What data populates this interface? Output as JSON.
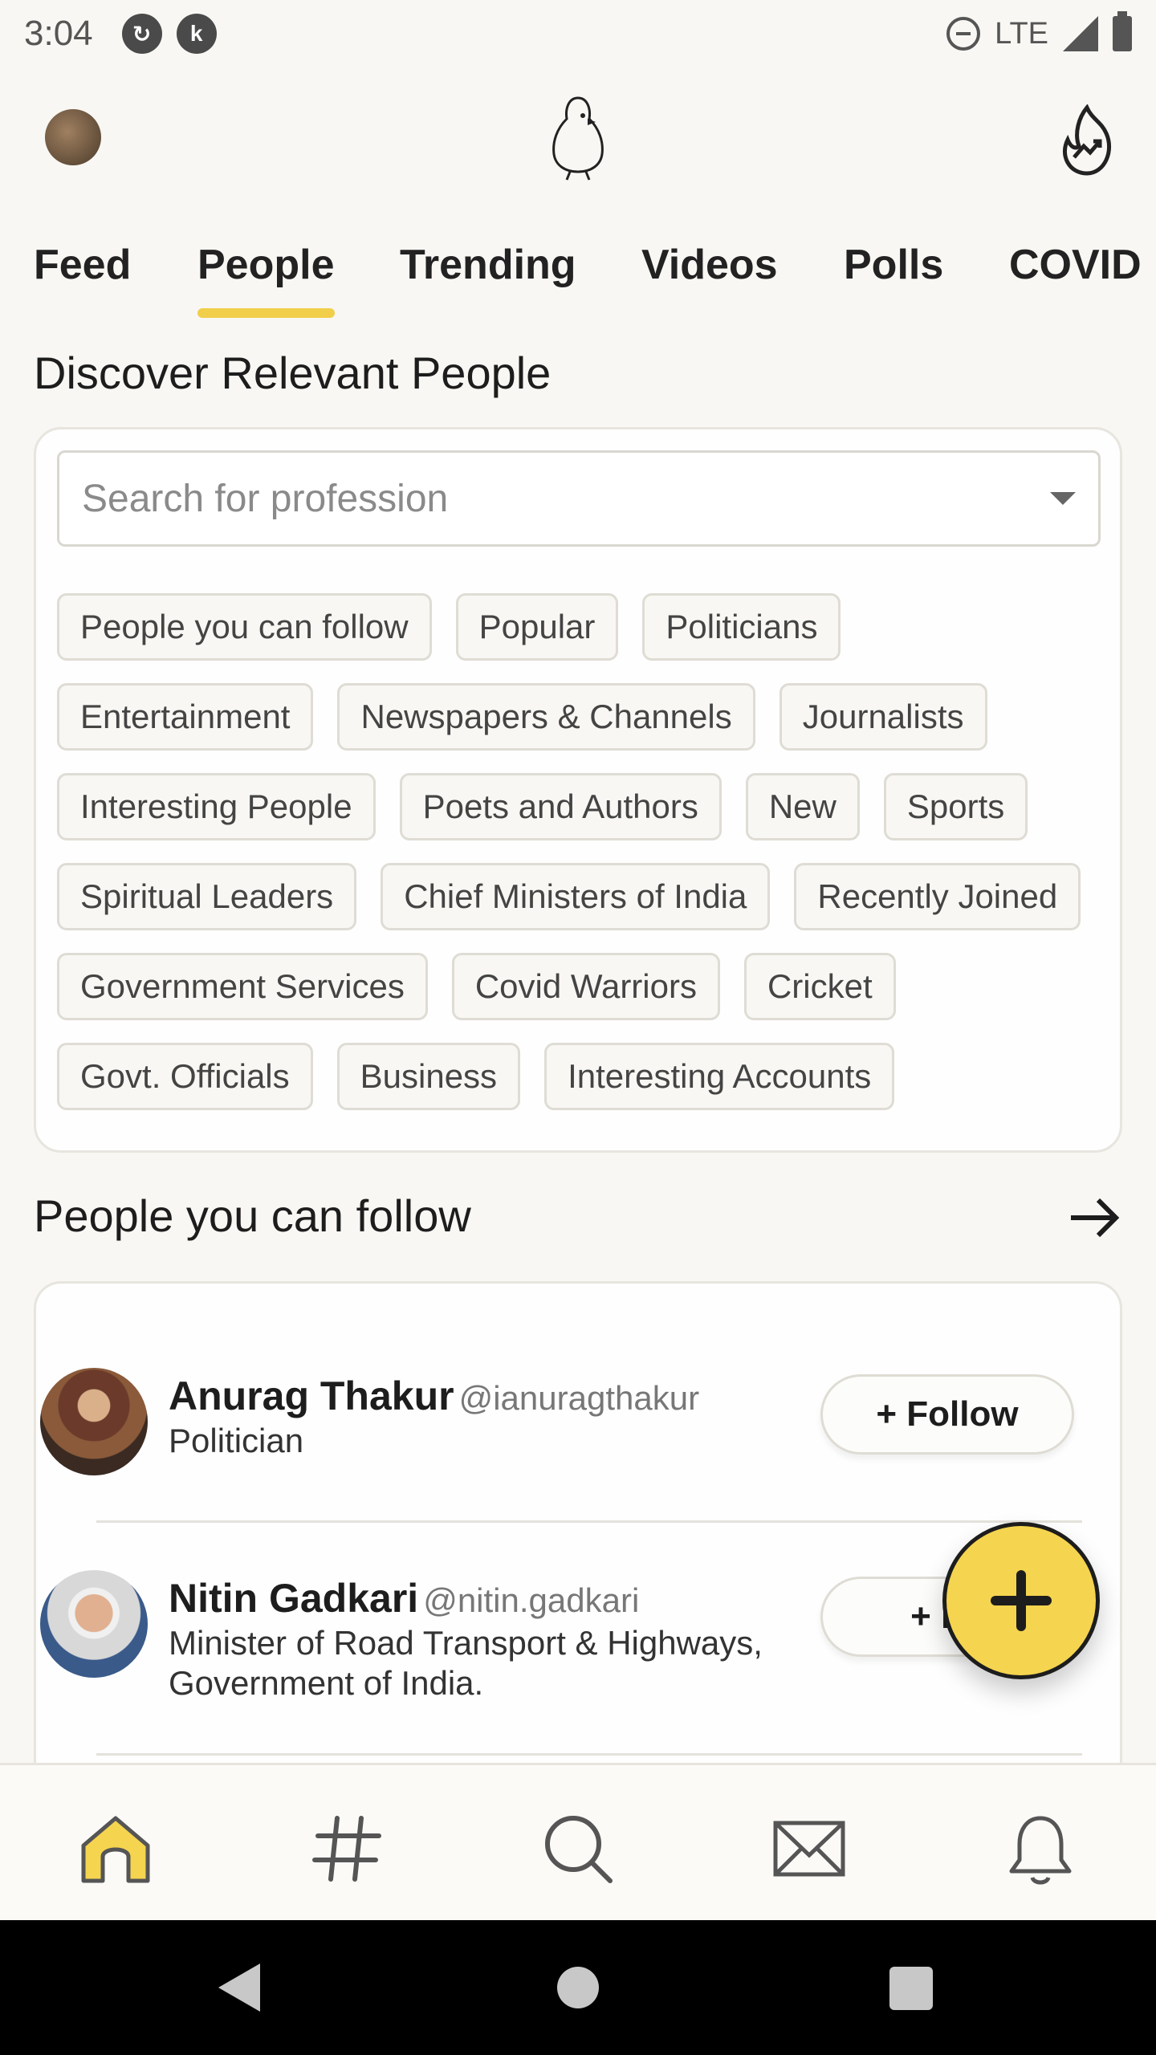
{
  "status_bar": {
    "time": "3:04",
    "network": "LTE"
  },
  "tabs": [
    {
      "label": "Feed"
    },
    {
      "label": "People"
    },
    {
      "label": "Trending"
    },
    {
      "label": "Videos"
    },
    {
      "label": "Polls"
    },
    {
      "label": "COVID"
    }
  ],
  "discover": {
    "title": "Discover Relevant People",
    "search_placeholder": "Search for profession",
    "chips": [
      [
        "People you can follow",
        "Popular",
        "Politicians"
      ],
      [
        "Entertainment",
        "Newspapers & Channels",
        "Journalists"
      ],
      [
        "Interesting People",
        "Poets and Authors",
        "New",
        "Sports"
      ],
      [
        "Spiritual Leaders",
        "Chief Ministers of India",
        "Recently Joined"
      ],
      [
        "Government Services",
        "Covid Warriors",
        "Cricket"
      ],
      [
        "Govt. Officials",
        "Business",
        "Interesting Accounts"
      ]
    ]
  },
  "follow_section": {
    "title": "People you can follow",
    "people": [
      {
        "name": "Anurag Thakur",
        "handle": "@ianuragthakur",
        "desc": "Politician",
        "button": "+ Follow"
      },
      {
        "name": "Nitin Gadkari",
        "handle": "@nitin.gadkari",
        "desc": "Minister of Road Transport & Highways, Government of India.",
        "button": "+ Fo"
      }
    ]
  },
  "fab": {
    "icon": "plus-icon"
  },
  "bottom_nav": [
    {
      "icon": "home-icon"
    },
    {
      "icon": "hashtag-icon"
    },
    {
      "icon": "search-icon"
    },
    {
      "icon": "mail-icon"
    },
    {
      "icon": "bell-icon"
    }
  ],
  "colors": {
    "accent": "#f2cf4a",
    "background": "#f8f7f3"
  }
}
